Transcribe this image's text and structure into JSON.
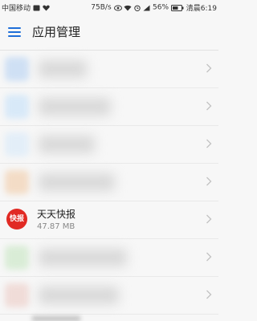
{
  "status_bar": {
    "carrier": "中国移动",
    "net_speed": "75B/s",
    "battery": "56%",
    "time_label": "清晨6:19",
    "icons": [
      "sim-icon",
      "heart-icon",
      "eye-icon",
      "wifi-icon",
      "alarm-icon",
      "signal-icon",
      "battery-icon"
    ]
  },
  "header": {
    "menu_icon": "hamburger-menu-icon",
    "title": "应用管理"
  },
  "list": {
    "rows": [
      {
        "blurred": true,
        "icon_color": "#cfe0f4"
      },
      {
        "blurred": true,
        "icon_color": "#d8e9f8"
      },
      {
        "blurred": true,
        "icon_color": "#e3eef8"
      },
      {
        "blurred": true,
        "icon_color": "#f3dcc6"
      },
      {
        "blurred": false,
        "name": "天天快报",
        "size": "47.87 MB",
        "icon_text": "快报",
        "icon_color": "#e12a24"
      },
      {
        "blurred": true,
        "icon_color": "#d9ecd6"
      },
      {
        "blurred": true,
        "icon_color": "#f0dcd8"
      }
    ]
  },
  "colors": {
    "accent": "#1e6ed8",
    "background": "#f7f7f7"
  }
}
